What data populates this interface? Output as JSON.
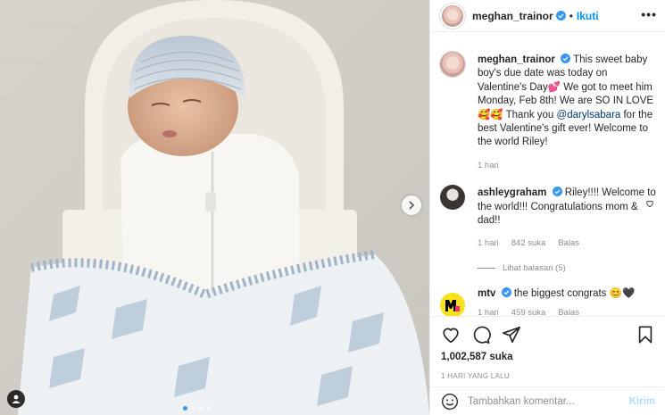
{
  "post": {
    "username": "meghan_trainor",
    "separator": "•",
    "follow_label": "Ikuti",
    "more_label": "•••"
  },
  "caption": {
    "username": "meghan_trainor",
    "text_1": "This sweet baby boy's due date was today on Valentine's Day💕 We got to meet him Monday, Feb 8th! We are SO IN LOVE🥰🥰 Thank you ",
    "mention": "@darylsabara",
    "text_2": " for the best Valentine's gift ever! Welcome to the world Riley!",
    "time": "1 hari"
  },
  "comments": [
    {
      "username": "ashleygraham",
      "text": "Riley!!!! Welcome to the world!!! Congratulations mom & dad!!",
      "time": "1 hari",
      "likes": "842 suka",
      "reply": "Balas",
      "view_replies": "Lihat balasan (5)"
    },
    {
      "username": "mtv",
      "text": "the biggest congrats 😊🖤",
      "time": "1 hari",
      "likes": "459 suka",
      "reply": "Balas"
    }
  ],
  "likes_count": "1,002,587 suka",
  "time_ago": "1 HARI YANG LALU",
  "composer": {
    "placeholder": "Tambahkan komentar...",
    "post_label": "Kirim"
  },
  "icons": {
    "like": "heart-icon",
    "comment": "comment-icon",
    "share": "share-icon",
    "save": "bookmark-icon",
    "emoji": "emoji-icon",
    "next": "chevron-right-icon",
    "tag": "user-tag-icon",
    "verified": "verified-badge-icon"
  },
  "colors": {
    "accent": "#0095f6",
    "mention": "#00376b",
    "muted": "#8e8e8e",
    "post_disabled": "#b2dffc"
  },
  "carousel": {
    "count": 4,
    "active_index": 0
  }
}
